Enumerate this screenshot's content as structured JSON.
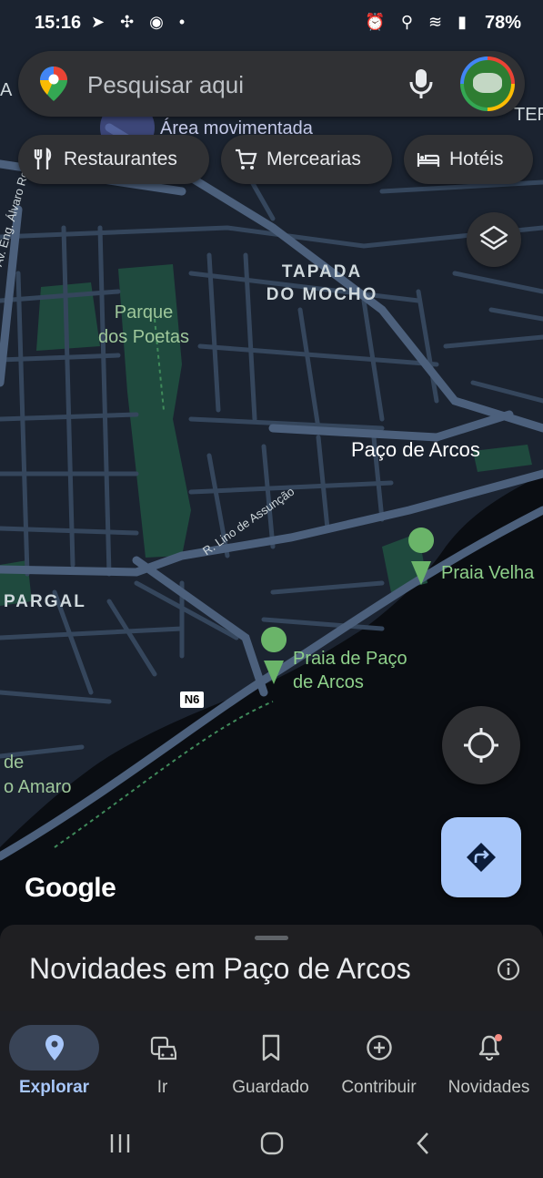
{
  "status_bar": {
    "time": "15:16",
    "left_icons": "➤ ✣ ◉ •",
    "right_icons": "⏰ ⚲ ≋ ▮",
    "battery": "78%"
  },
  "search": {
    "placeholder": "Pesquisar aqui",
    "mic_icon": "mic-icon",
    "avatar_icon": "profile-avatar"
  },
  "chips": [
    {
      "label": "Restaurantes",
      "icon": "fork-knife-icon"
    },
    {
      "label": "Mercearias",
      "icon": "cart-icon"
    },
    {
      "label": "Hotéis",
      "icon": "bed-icon"
    }
  ],
  "map": {
    "labels": {
      "area_busy": "Área movimentada",
      "tapada_line1": "TAPADA",
      "tapada_line2": "DO MOCHO",
      "parque_line1": "Parque",
      "parque_line2": "dos Poetas",
      "paco_de_arcos": "Paço de Arcos",
      "praia_velha": "Praia Velha",
      "praia_paco_line1": "Praia de Paço",
      "praia_paco_line2": "de Arcos",
      "pargal": "PARGAL",
      "av_eng": "Av. Eng. Álvaro Roquette",
      "rua_lino": "R. Lino de Assunção",
      "n6": "N6",
      "edge_left_top": "A",
      "edge_right_top": "TER",
      "amaro_line1": "de",
      "amaro_line2": "o Amaro"
    },
    "attribution": "Google",
    "colors": {
      "land": "#1b2330",
      "water": "#0a0d12",
      "roads": "#3f5169",
      "major_roads": "#5a6f8c",
      "park": "#1f4a3e",
      "poi_green": "#6ab469",
      "accent_blue": "#a8c7fa"
    }
  },
  "sheet": {
    "title": "Novidades em Paço de Arcos",
    "info_icon": "info-icon"
  },
  "bottom_nav": [
    {
      "label": "Explorar",
      "icon": "pin-icon",
      "active": true
    },
    {
      "label": "Ir",
      "icon": "commute-icon",
      "active": false
    },
    {
      "label": "Guardado",
      "icon": "bookmark-icon",
      "active": false
    },
    {
      "label": "Contribuir",
      "icon": "add-circle-icon",
      "active": false
    },
    {
      "label": "Novidades",
      "icon": "bell-icon",
      "active": false,
      "badge": true
    }
  ],
  "system_nav": [
    "recents-button",
    "home-button",
    "back-button"
  ]
}
